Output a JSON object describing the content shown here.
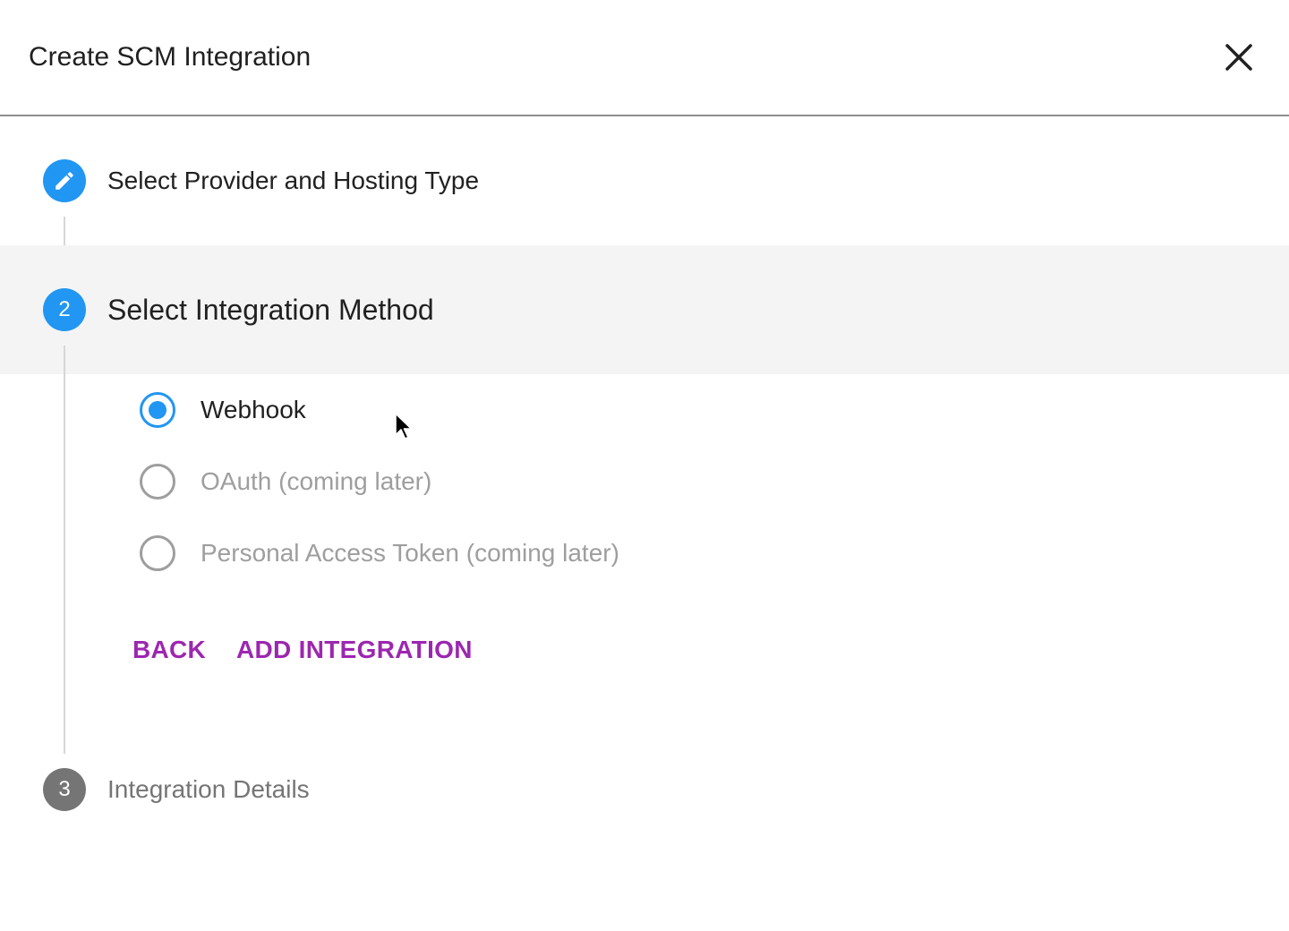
{
  "dialog": {
    "title": "Create SCM Integration",
    "close_icon": "close-icon"
  },
  "stepper": {
    "steps": [
      {
        "label": "Select Provider and Hosting Type",
        "indicator_icon": "edit-pencil-icon",
        "state": "completed"
      },
      {
        "number": "2",
        "label": "Select Integration Method",
        "state": "active"
      },
      {
        "number": "3",
        "label": "Integration Details",
        "state": "inactive"
      }
    ]
  },
  "integration_method": {
    "selected": "Webhook",
    "options": [
      {
        "label": "Webhook",
        "checked": true,
        "disabled": false
      },
      {
        "label": "OAuth (coming later)",
        "checked": false,
        "disabled": true
      },
      {
        "label": "Personal Access Token (coming later)",
        "checked": false,
        "disabled": true
      }
    ]
  },
  "actions": {
    "back_label": "BACK",
    "add_label": "ADD INTEGRATION"
  },
  "colors": {
    "primary": "#2196f3",
    "action": "#9c27b0",
    "inactive_step": "#757575",
    "active_step_bg": "#f4f4f4"
  }
}
